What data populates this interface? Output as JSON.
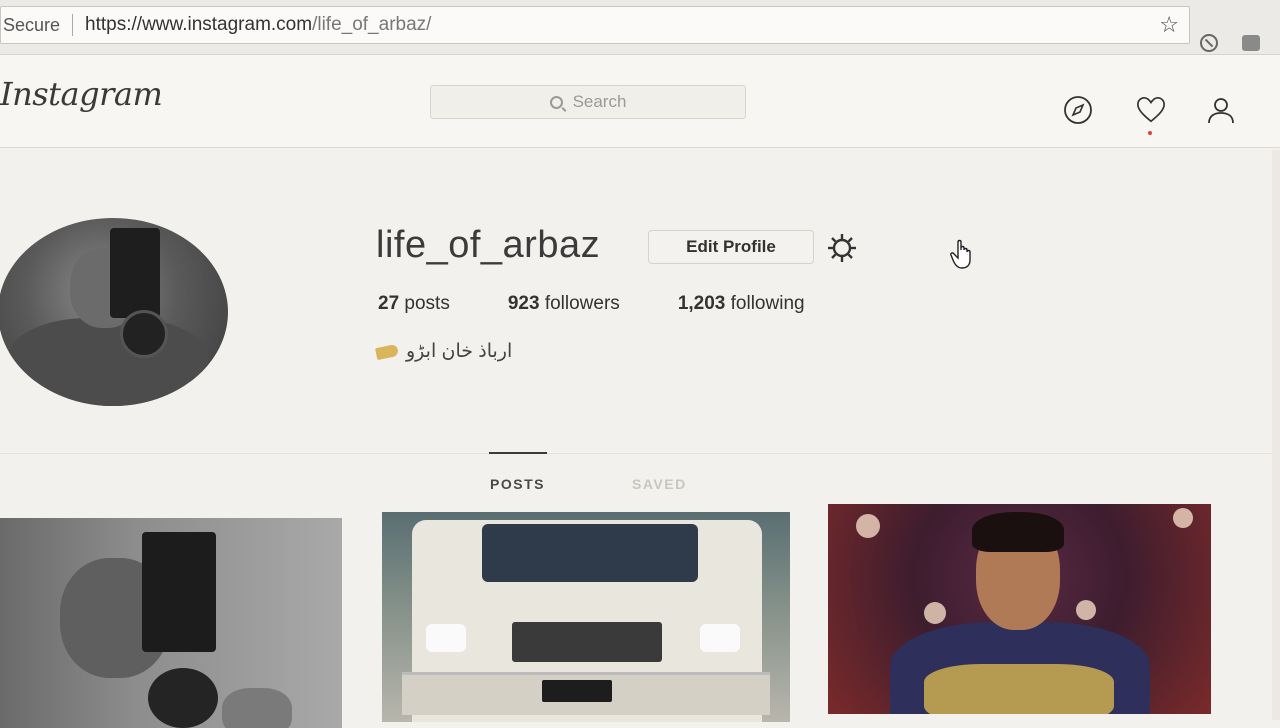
{
  "browser": {
    "secure_label": "Secure",
    "url_host": "https://www.instagram.com",
    "url_path": "/life_of_arbaz/",
    "bookmark_icon": "star-icon"
  },
  "header": {
    "logo": "Instagram",
    "search_placeholder": "Search",
    "icons": [
      "compass-icon",
      "heart-icon",
      "user-icon"
    ]
  },
  "profile": {
    "username": "life_of_arbaz",
    "edit_button": "Edit Profile",
    "settings_icon": "gear-icon",
    "stats": {
      "posts_count": "27",
      "posts_label": "posts",
      "followers_count": "923",
      "followers_label": "followers",
      "following_count": "1,203",
      "following_label": "following"
    },
    "bio": "ارباذ خان ابڑو"
  },
  "tabs": [
    {
      "label": "POSTS",
      "active": true
    },
    {
      "label": "SAVED",
      "active": false
    }
  ],
  "colors": {
    "background": "#f3f1ed",
    "text": "#262626",
    "notification_dot": "#e0413f"
  }
}
